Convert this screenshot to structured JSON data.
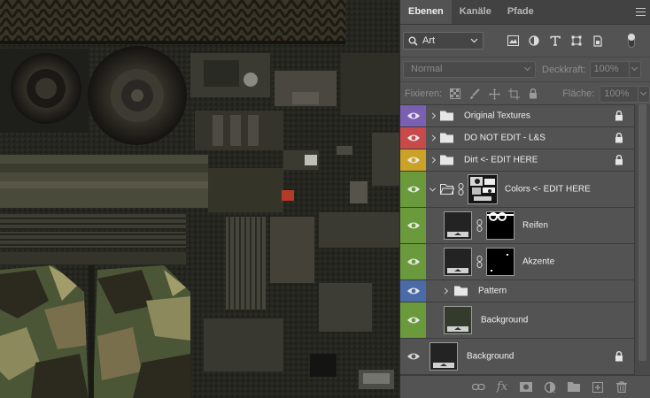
{
  "panel": {
    "tabs": [
      {
        "label": "Ebenen",
        "active": true
      },
      {
        "label": "Kanäle",
        "active": false
      },
      {
        "label": "Pfade",
        "active": false
      }
    ],
    "menu_icon": "hamburger-icon"
  },
  "filter": {
    "kind_value": "Art",
    "icons": [
      "pixel-filter-icon",
      "adjustment-filter-icon",
      "type-filter-icon",
      "shape-filter-icon",
      "smart-object-filter-icon"
    ]
  },
  "blend": {
    "mode": "Normal",
    "opacity_label": "Deckkraft:",
    "opacity_value": "100%"
  },
  "locks": {
    "label": "Fixieren:",
    "fill_label": "Fläche:",
    "fill_value": "100%"
  },
  "layers": [
    {
      "name": "Original Textures",
      "type": "group",
      "color": "#7b5fb3",
      "locked": true,
      "expanded": false,
      "indent": 0
    },
    {
      "name": "DO NOT EDIT  - L&S",
      "type": "group",
      "color": "#c84a4a",
      "locked": true,
      "expanded": false,
      "indent": 0
    },
    {
      "name": "Dirt <- EDIT HERE",
      "type": "group",
      "color": "#c9a227",
      "locked": true,
      "expanded": false,
      "indent": 0
    },
    {
      "name": "Colors <- EDIT HERE",
      "type": "group",
      "color": "#6a9a3c",
      "locked": false,
      "expanded": true,
      "indent": 0
    },
    {
      "name": "Reifen",
      "type": "fill",
      "color": "#6a9a3c",
      "locked": false,
      "indent": 1
    },
    {
      "name": "Akzente",
      "type": "fill",
      "color": "#6a9a3c",
      "locked": false,
      "indent": 1
    },
    {
      "name": "Pattern",
      "type": "group",
      "color": "#4a6aa8",
      "locked": false,
      "expanded": false,
      "indent": 1
    },
    {
      "name": "Background",
      "type": "fill",
      "color": "#6a9a3c",
      "locked": false,
      "indent": 1
    },
    {
      "name": "Background",
      "type": "background",
      "color": "",
      "locked": true,
      "indent": 0
    }
  ],
  "bottom_icons": [
    "link-layers-icon",
    "fx-icon",
    "add-mask-icon",
    "adjustment-layer-icon",
    "new-group-icon",
    "new-layer-icon",
    "delete-layer-icon"
  ],
  "colors": {
    "panel_bg": "#535353",
    "tab_bar": "#424242",
    "purple": "#7b5fb3",
    "red": "#c84a4a",
    "yellow": "#c9a227",
    "green": "#6a9a3c",
    "blue": "#4a6aa8"
  }
}
